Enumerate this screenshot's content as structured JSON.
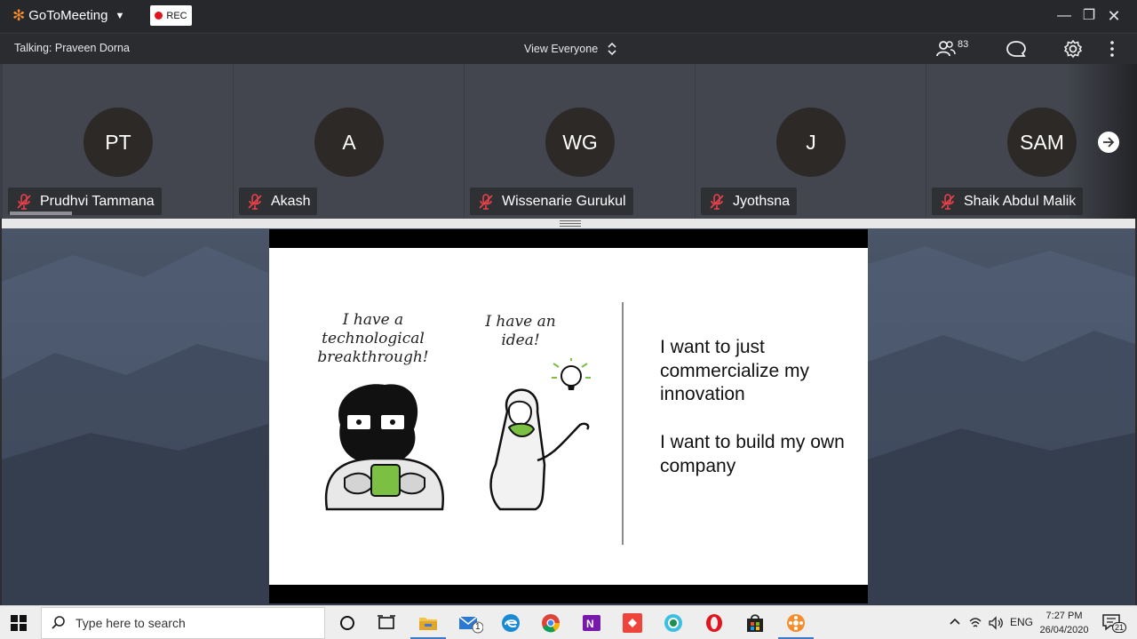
{
  "app": {
    "brand_name": "GoToMeeting",
    "rec_label": "REC"
  },
  "infobar": {
    "talking": "Talking: Praveen Dorna",
    "view_label": "View Everyone",
    "attendee_count": "83"
  },
  "participants": [
    {
      "initials": "PT",
      "name": "Prudhvi Tammana"
    },
    {
      "initials": "A",
      "name": "Akash"
    },
    {
      "initials": "WG",
      "name": "Wissenarie Gurukul"
    },
    {
      "initials": "J",
      "name": "Jyothsna"
    },
    {
      "initials": "SAM",
      "name": "Shaik Abdul Malik"
    }
  ],
  "slide": {
    "cartoon1_caption": "I have a technological breakthrough!",
    "cartoon2_caption": "I have an idea!",
    "text1": "I want to just commercialize my innovation",
    "text2": "I want to build my own company"
  },
  "taskbar": {
    "search_placeholder": "Type here to search",
    "mail_badge": "1",
    "language": "ENG",
    "time": "7:27 PM",
    "date": "26/04/2020",
    "notifications": "21"
  },
  "colors": {
    "brand_orange": "#f68d2e",
    "rec_red": "#e0161f",
    "mic_muted": "#e8404a",
    "bulb_green": "#7bc043"
  }
}
